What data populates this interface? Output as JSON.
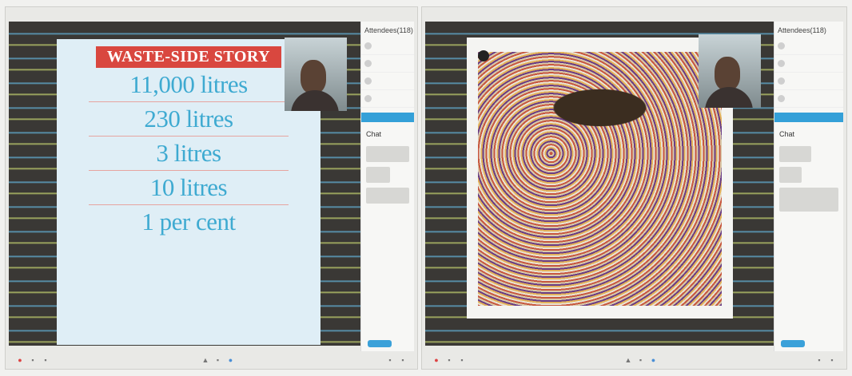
{
  "panel_left": {
    "sidebar": {
      "attendees_title": "Attendees(118)",
      "chat_title": "Chat"
    },
    "slide": {
      "headline": "WASTE-SIDE STORY",
      "stats": [
        {
          "value": "11,000 litres"
        },
        {
          "value": "230 litres"
        },
        {
          "value": "3 litres"
        },
        {
          "value": "10 litres"
        },
        {
          "value": "1 per cent"
        }
      ]
    }
  },
  "panel_right": {
    "sidebar": {
      "attendees_title": "Attendees(118)",
      "chat_title": "Chat"
    }
  },
  "colors": {
    "headline_bg": "#d9473f",
    "stat_text": "#3eaad1",
    "accent_blue": "#34a0d8"
  },
  "icons": [
    "mic-icon",
    "camera-icon",
    "share-icon",
    "raise-hand-icon",
    "leave-icon"
  ]
}
